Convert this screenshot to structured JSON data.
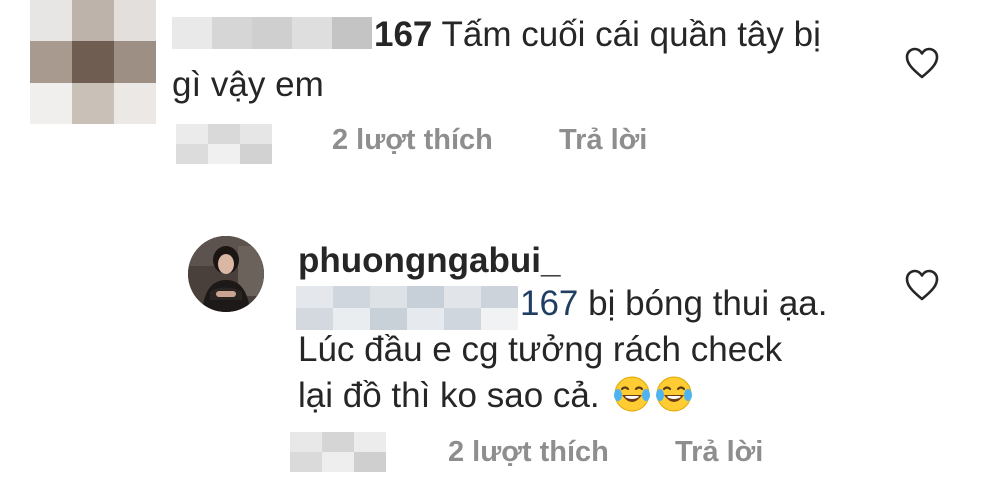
{
  "comment": {
    "mention_suffix": "167",
    "text_line1": "Tấm cuối cái quần tây bị",
    "text_line2": "gì vậy em",
    "likes_label": "2 lượt thích",
    "reply_label": "Trả lời",
    "liked": false
  },
  "reply": {
    "username": "phuongngabui_",
    "mention_suffix": "167",
    "text_line1": "bị bóng thui ạa.",
    "text_line2": "Lúc đầu e cg tưởng rách check",
    "text_line3": "lại đồ thì ko sao cả.",
    "emojis": [
      "face-with-tears-of-joy-icon",
      "face-with-tears-of-joy-icon"
    ],
    "likes_label": "2 lượt thích",
    "reply_label": "Trả lời",
    "liked": false
  },
  "colors": {
    "text": "#262626",
    "meta": "#8e8e8e",
    "mention_link": "#1f3e61",
    "heart_stroke": "#262626"
  }
}
